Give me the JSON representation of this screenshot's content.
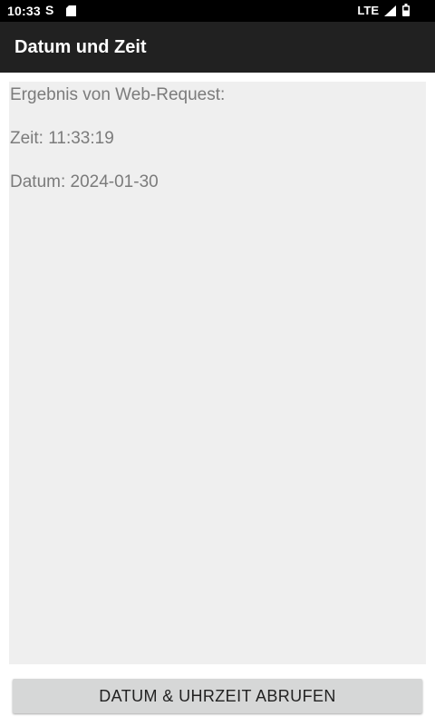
{
  "status_bar": {
    "time": "10:33",
    "s_icon_glyph": "S",
    "network": "LTE",
    "icons": [
      "s-icon",
      "sd-card-icon",
      "signal-icon",
      "battery-icon"
    ]
  },
  "app_bar": {
    "title": "Datum und Zeit",
    "background": "#212121"
  },
  "result": {
    "heading": "Ergebnis von Web-Request:",
    "time_line": "Zeit: 11:33:19",
    "date_line": "Datum: 2024-01-30",
    "background": "#efefef",
    "text_color": "#7b7b7b"
  },
  "button": {
    "label": "DATUM & UHRZEIT ABRUFEN",
    "background": "#d6d7d7"
  }
}
